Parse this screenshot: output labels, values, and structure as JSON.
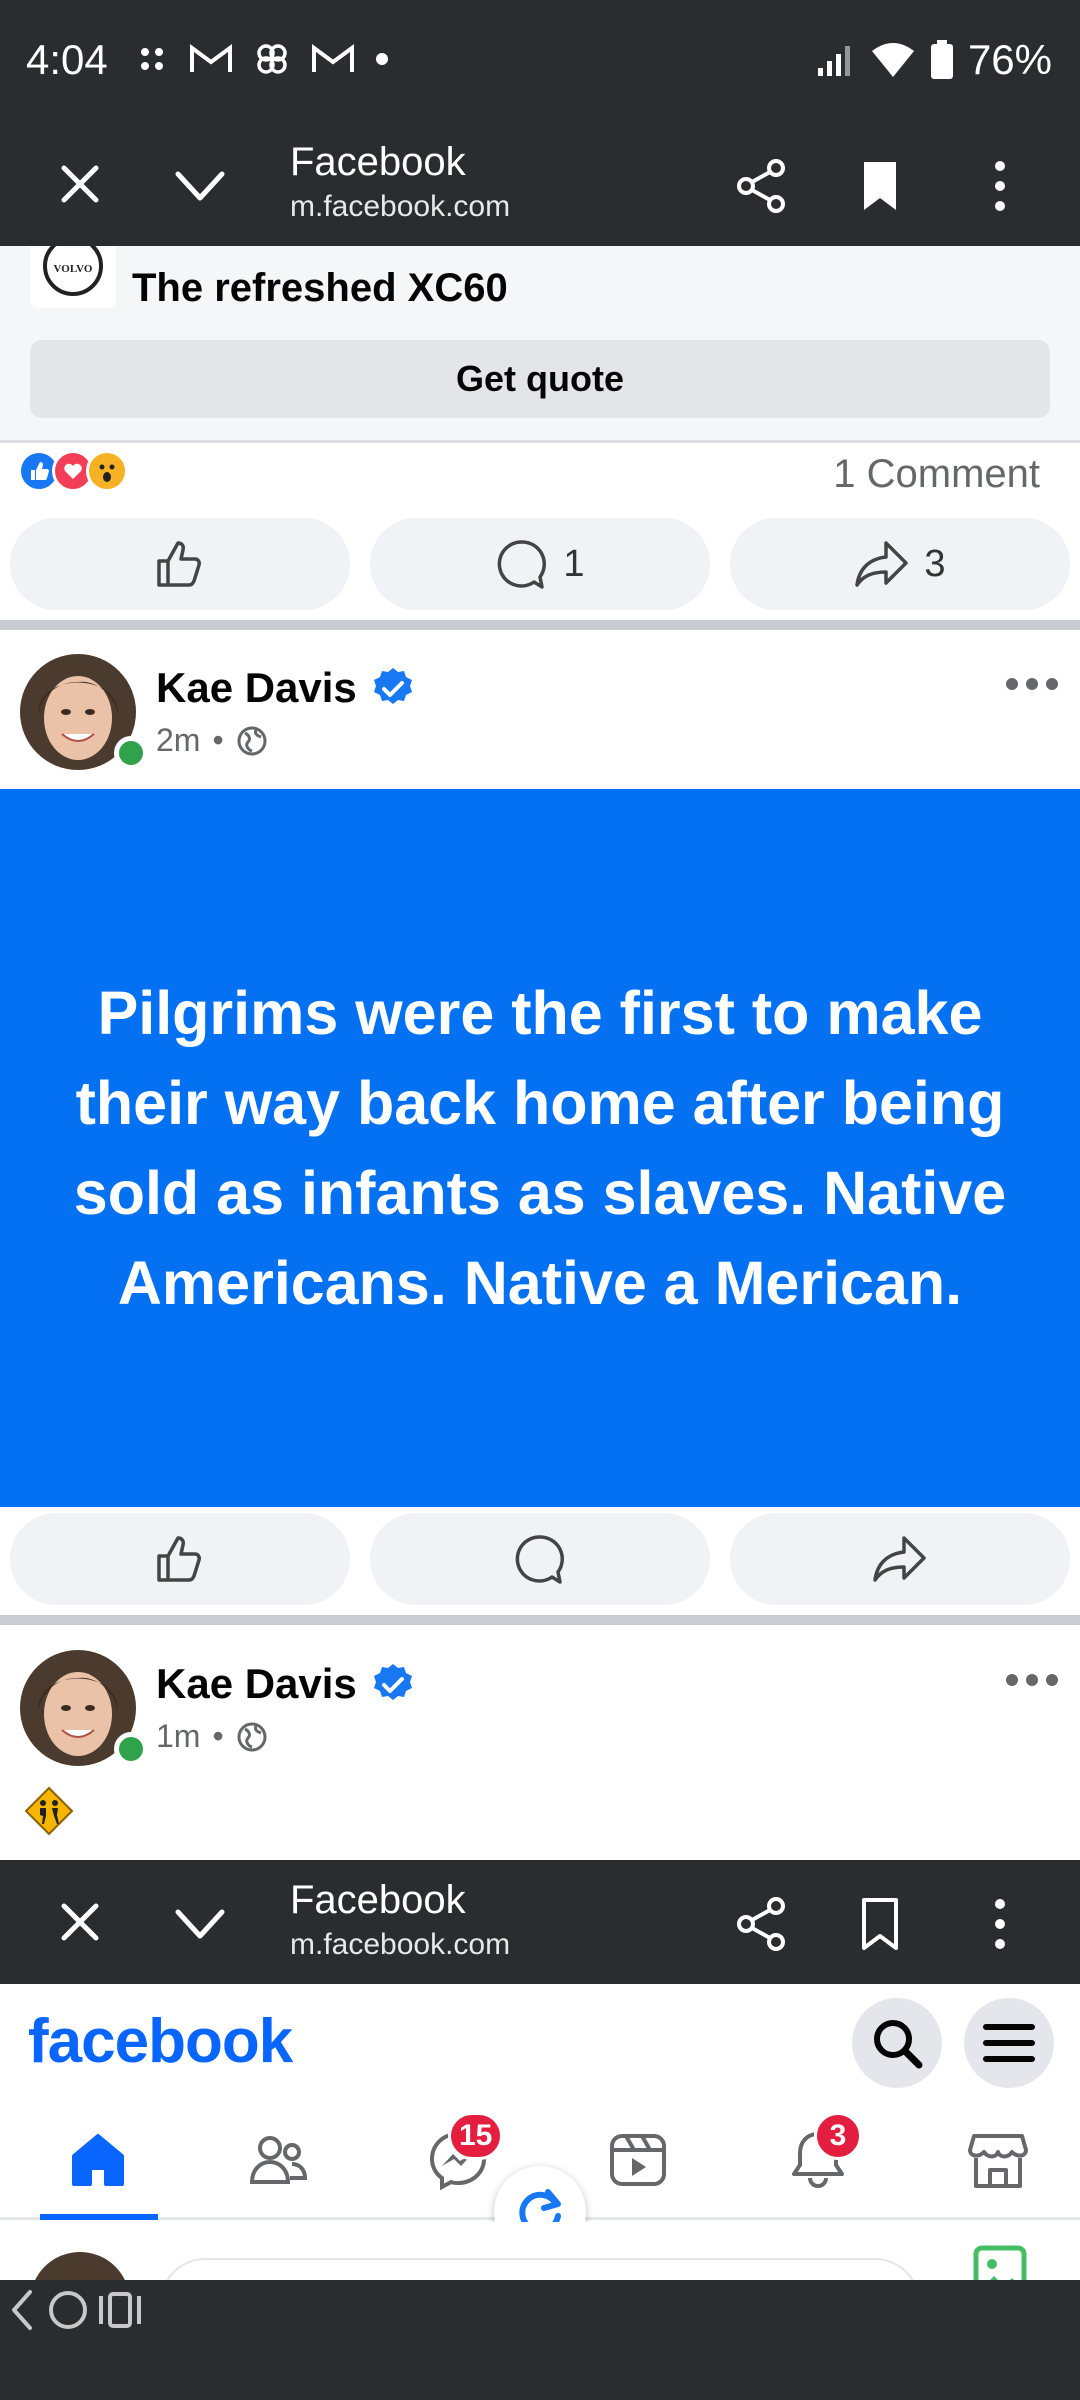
{
  "status_bar": {
    "time": "4:04",
    "battery": "76%"
  },
  "browser": {
    "title": "Facebook",
    "url": "m.facebook.com"
  },
  "ad": {
    "brand_logo_text": "VOLVO",
    "title": "The refreshed XC60",
    "cta": "Get quote"
  },
  "post1_footer": {
    "comments_label": "1 Comment",
    "comment_count": "1",
    "share_count": "3"
  },
  "post2": {
    "author": "Kae Davis",
    "time": "2m",
    "text": "Pilgrims were the first to make their way back home after being sold as infants as slaves. Native Americans. Native a Merican.",
    "background_color": "#0470f2"
  },
  "post3": {
    "author": "Kae Davis",
    "time": "1m"
  },
  "fb_header": {
    "logo": "facebook"
  },
  "fb_nav": {
    "messages_badge": "15",
    "notifications_badge": "3"
  },
  "colors": {
    "facebook_blue": "#0866ff",
    "badge_red": "#e41e3f",
    "online_green": "#31a24c"
  }
}
